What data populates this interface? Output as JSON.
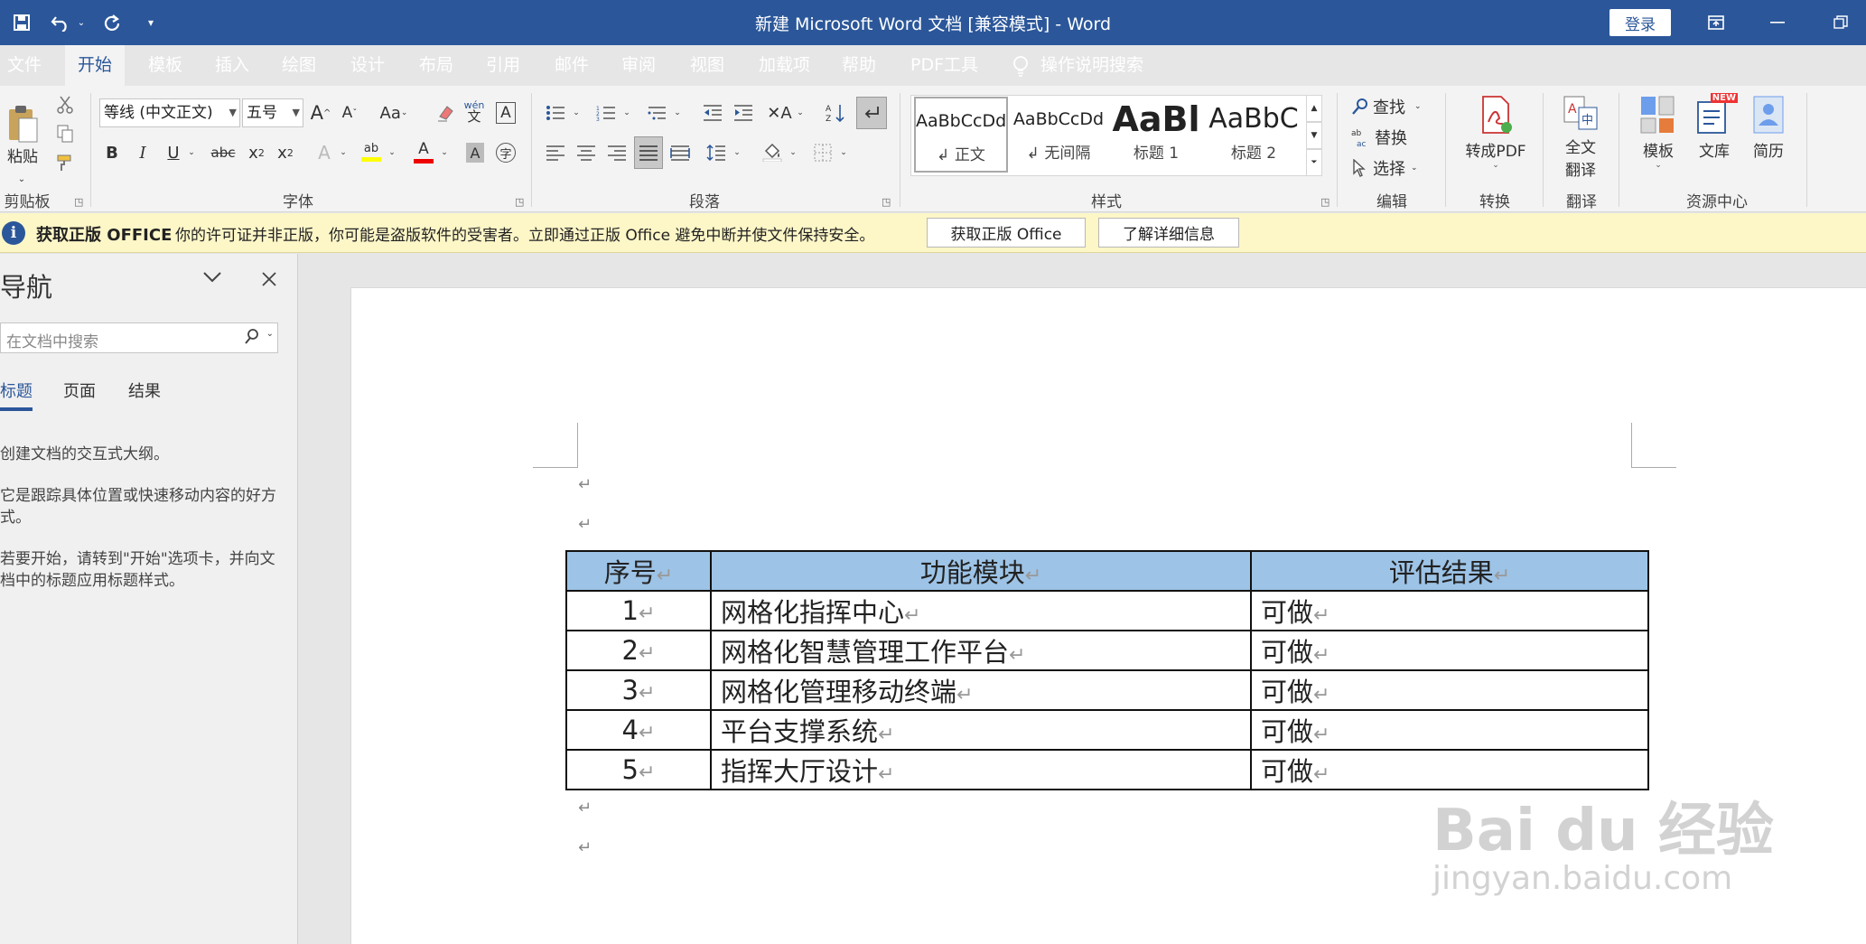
{
  "window": {
    "title": "新建 Microsoft Word 文档 [兼容模式] - Word",
    "login": "登录"
  },
  "tabs": [
    "文件",
    "开始",
    "模板",
    "插入",
    "绘图",
    "设计",
    "布局",
    "引用",
    "邮件",
    "审阅",
    "视图",
    "加载项",
    "帮助",
    "PDF工具"
  ],
  "tell_me": "操作说明搜索",
  "ribbon": {
    "clipboard": {
      "paste": "粘贴",
      "label": "剪贴板"
    },
    "font": {
      "name": "等线 (中文正文)",
      "size": "五号",
      "label": "字体",
      "change_case": "Aa",
      "wen": "wén"
    },
    "paragraph": {
      "label": "段落"
    },
    "styles": {
      "label": "样式",
      "items": [
        {
          "preview": "AaBbCcDd",
          "name": "↲ 正文"
        },
        {
          "preview": "AaBbCcDd",
          "name": "↲ 无间隔"
        },
        {
          "preview": "AaBl",
          "name": "标题 1"
        },
        {
          "preview": "AaBbC",
          "name": "标题 2"
        }
      ]
    },
    "editing": {
      "find": "查找",
      "replace": "替换",
      "select": "选择",
      "label": "编辑"
    },
    "convert": {
      "to_pdf": "转成PDF",
      "label": "转换"
    },
    "translate": {
      "full_line1": "全文",
      "full_line2": "翻译",
      "label": "翻译"
    },
    "resources": {
      "template": "模板",
      "library": "文库",
      "resume": "简历",
      "new_badge": "NEW",
      "label": "资源中心"
    }
  },
  "infobar": {
    "title": "获取正版 OFFICE",
    "message": "你的许可证并非正版，你可能是盗版软件的受害者。立即通过正版 Office 避免中断并使文件保持安全。",
    "btn_get": "获取正版 Office",
    "btn_more": "了解详细信息"
  },
  "nav": {
    "title": "导航",
    "search_placeholder": "在文档中搜索",
    "tabs": [
      "标题",
      "页面",
      "结果"
    ],
    "help1": "创建文档的交互式大纲。",
    "help2": "它是跟踪具体位置或快速移动内容的好方式。",
    "help3": "若要开始，请转到\"开始\"选项卡，并向文档中的标题应用标题样式。"
  },
  "table": {
    "headers": [
      "序号",
      "功能模块",
      "评估结果"
    ],
    "rows": [
      [
        "1",
        "网格化指挥中心",
        "可做"
      ],
      [
        "2",
        "网格化智慧管理工作平台",
        "可做"
      ],
      [
        "3",
        "网格化管理移动终端",
        "可做"
      ],
      [
        "4",
        "平台支撑系统",
        "可做"
      ],
      [
        "5",
        "指挥大厅设计",
        "可做"
      ]
    ]
  },
  "para_mark": "↵",
  "watermark": {
    "logo": "Bai du 经验",
    "url": "jingyan.baidu.com"
  },
  "colors": {
    "brand": "#2b579a",
    "header_fill": "#9dc3e6"
  }
}
